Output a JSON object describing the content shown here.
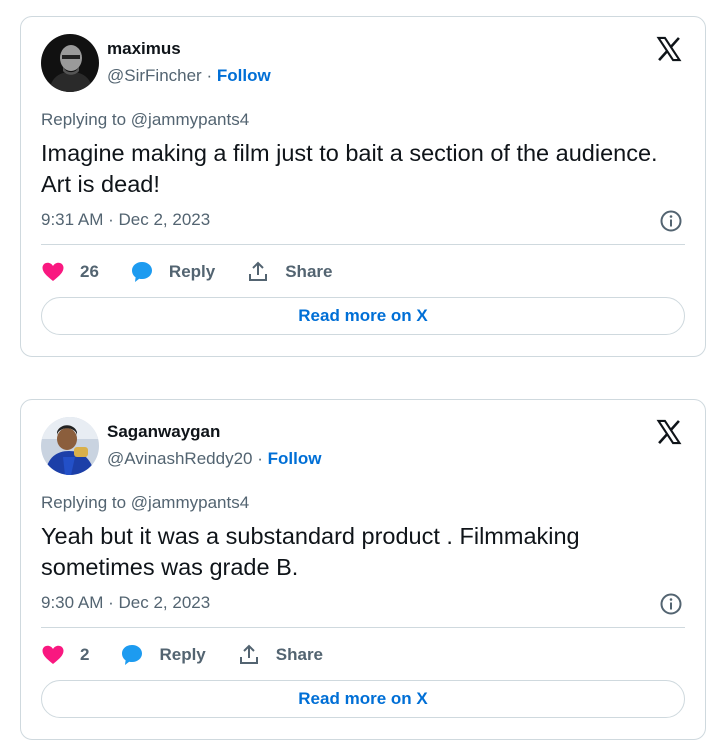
{
  "tweets": [
    {
      "display_name": "maximus",
      "handle": "@SirFincher",
      "separator": "·",
      "follow_label": "Follow",
      "replying_prefix": "Replying to",
      "replying_to": "@jammypants4",
      "text": "Imagine making a film just to bait a section of the audience. Art is dead!",
      "time": "9:31 AM",
      "date": "Dec 2, 2023",
      "likes": "26",
      "reply_label": "Reply",
      "share_label": "Share",
      "read_more_label": "Read more on X",
      "avatar_icon": "person-avatar-dark"
    },
    {
      "display_name": "Saganwaygan",
      "handle": "@AvinashReddy20",
      "separator": "·",
      "follow_label": "Follow",
      "replying_prefix": "Replying to",
      "replying_to": "@jammypants4",
      "text": "Yeah but it was a substandard product . Filmmaking sometimes was grade B.",
      "time": "9:30 AM",
      "date": "Dec 2, 2023",
      "likes": "2",
      "reply_label": "Reply",
      "share_label": "Share",
      "read_more_label": "Read more on X",
      "avatar_icon": "person-avatar-blue"
    }
  ],
  "colors": {
    "link_blue": "#006fd6",
    "heart_pink": "#f91880",
    "reply_blue": "#1d9bf0",
    "muted_text": "#536471",
    "border": "#cfd9de"
  },
  "icons": [
    "x-logo-icon",
    "info-icon",
    "heart-icon",
    "reply-bubble-icon",
    "share-icon"
  ]
}
